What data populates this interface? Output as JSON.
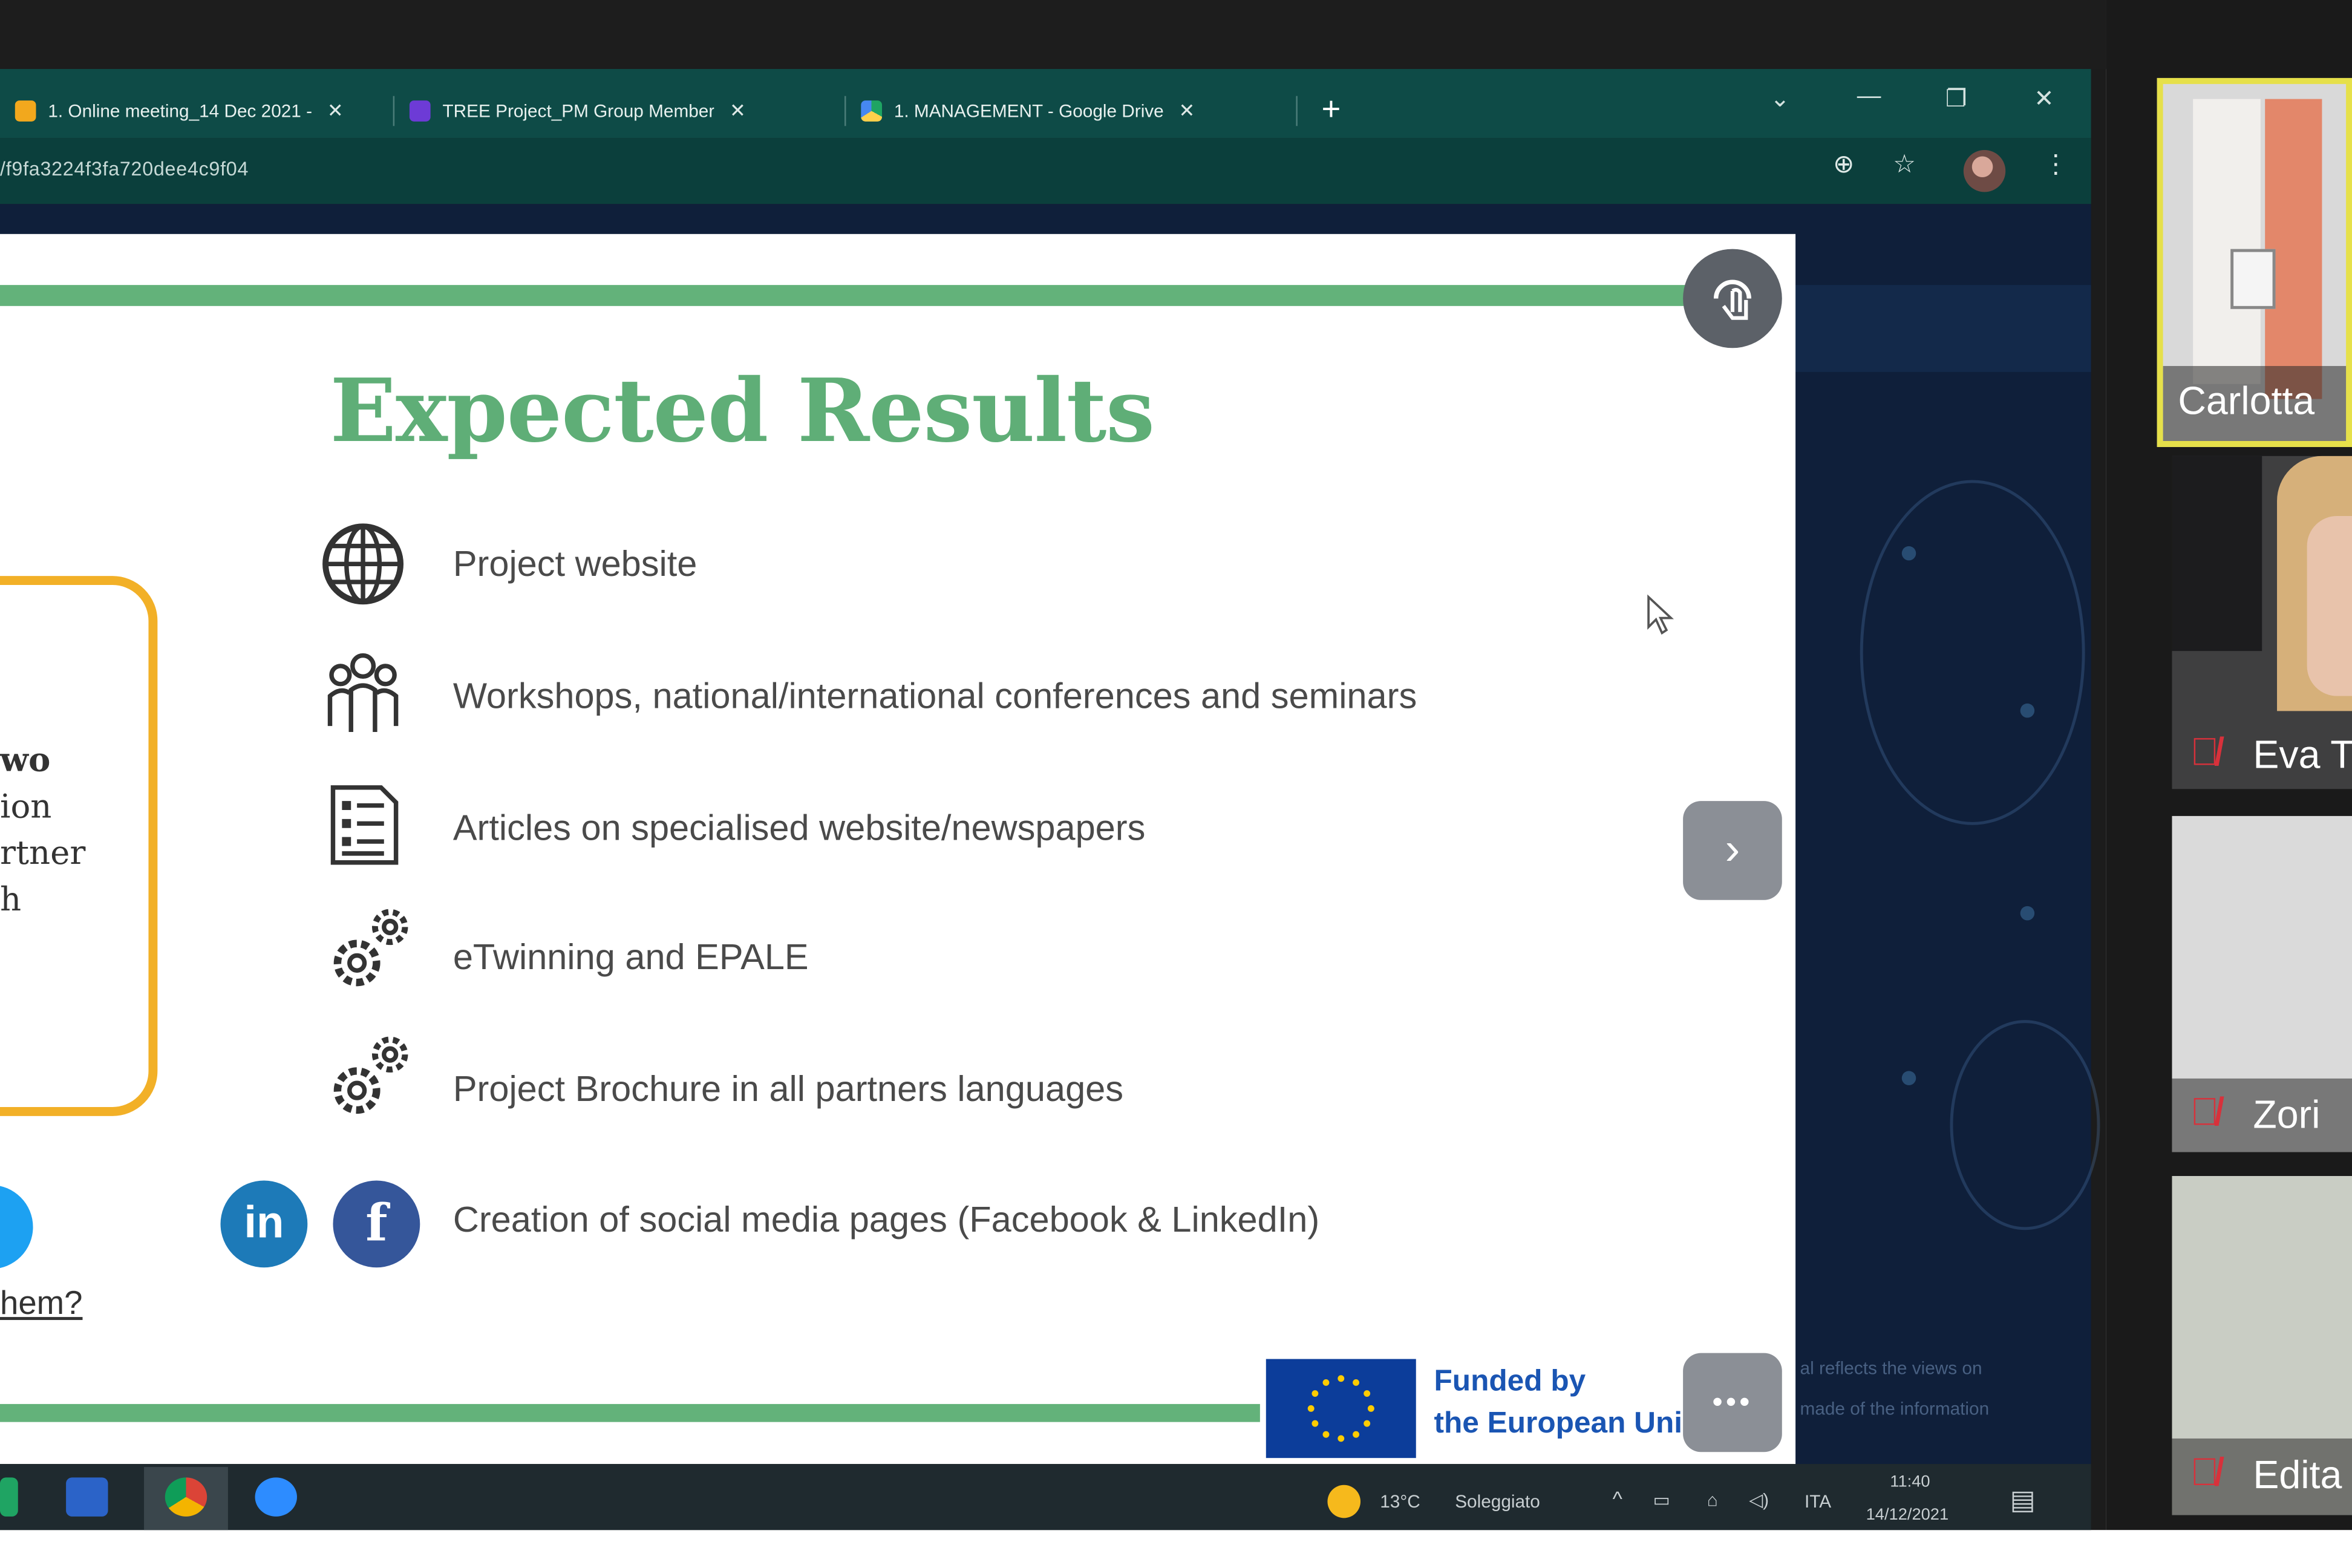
{
  "browser": {
    "tabs": [
      {
        "title": "1. Online meeting_14 Dec 2021 -",
        "favicon_color": "#f2a81d"
      },
      {
        "title": "TREE Project_PM Group Member",
        "favicon_color": "#6d3bd6"
      },
      {
        "title": "1. MANAGEMENT - Google Drive",
        "favicon_color": "#1fa463"
      }
    ],
    "new_tab": "+",
    "url": "/f9fa3224f3fa720dee4c9f04"
  },
  "slide": {
    "title": "Expected Results",
    "items": [
      {
        "icon": "globe-icon",
        "text": "Project website"
      },
      {
        "icon": "people-group-icon",
        "text": "Workshops, national/international conferences and seminars"
      },
      {
        "icon": "document-list-icon",
        "text": "Articles on specialised website/newspapers"
      },
      {
        "icon": "gears-icon",
        "text": "eTwinning and EPALE"
      },
      {
        "icon": "gears-icon",
        "text": "Project Brochure in all partners languages"
      },
      {
        "icon": "social-media-icon",
        "text": "Creation of social media pages (Facebook & LinkedIn)"
      }
    ],
    "frame_lines": [
      "wo",
      "ion",
      "rtner",
      "h"
    ],
    "link_text": "hem?",
    "social": {
      "linkedin": "in",
      "facebook": "f"
    },
    "eu": {
      "line1": "Funded by",
      "line2": "the European Union"
    },
    "bottom_right_text": [
      "al reflects the views on",
      "made of the information"
    ],
    "more_button": "•••",
    "next_button": "›"
  },
  "taskbar": {
    "weather": "13°C",
    "weather_desc": "Soleggiato",
    "lang": "ITA",
    "time": "11:40",
    "date": "14/12/2021"
  },
  "participants": [
    {
      "name": "Carlotta",
      "muted": false,
      "active": true
    },
    {
      "name": "Eva T",
      "muted": true,
      "active": false
    },
    {
      "name": "Zori",
      "muted": true,
      "active": false
    },
    {
      "name": "Edita",
      "muted": true,
      "active": false
    }
  ],
  "colors": {
    "slide_green": "#5fae77",
    "frame_yellow": "#f2b027",
    "browser_teal": "#0e4b47",
    "eu_blue": "#0c3d9a"
  }
}
